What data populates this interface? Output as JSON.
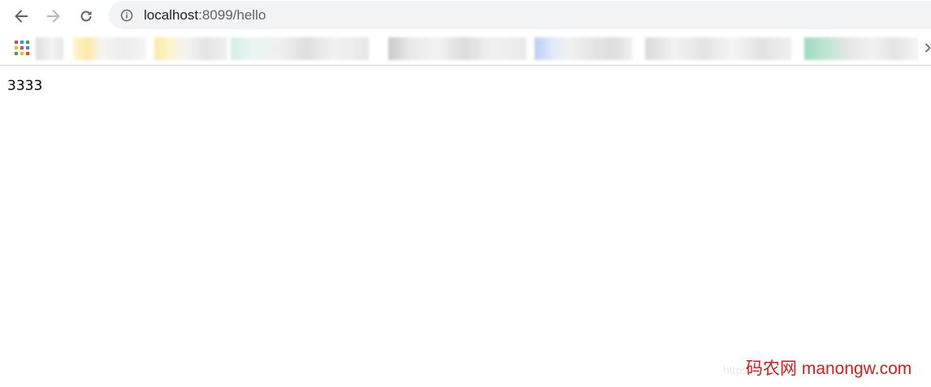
{
  "toolbar": {
    "back_icon": "arrow-left-icon",
    "forward_icon": "arrow-right-icon",
    "reload_icon": "reload-icon",
    "info_icon": "info-icon"
  },
  "address_bar": {
    "host": "localhost",
    "rest": ":8099/hello"
  },
  "bookmarks_bar": {
    "apps_icon": "apps-grid-icon",
    "overflow_icon": "chevron-right-icon"
  },
  "page": {
    "text": "3333"
  },
  "watermark": {
    "text": "码农网 manongw.com",
    "ghost": "https://"
  },
  "colors": {
    "watermark": "#cc1f1f",
    "omnibox_bg": "#f1f3f4"
  }
}
